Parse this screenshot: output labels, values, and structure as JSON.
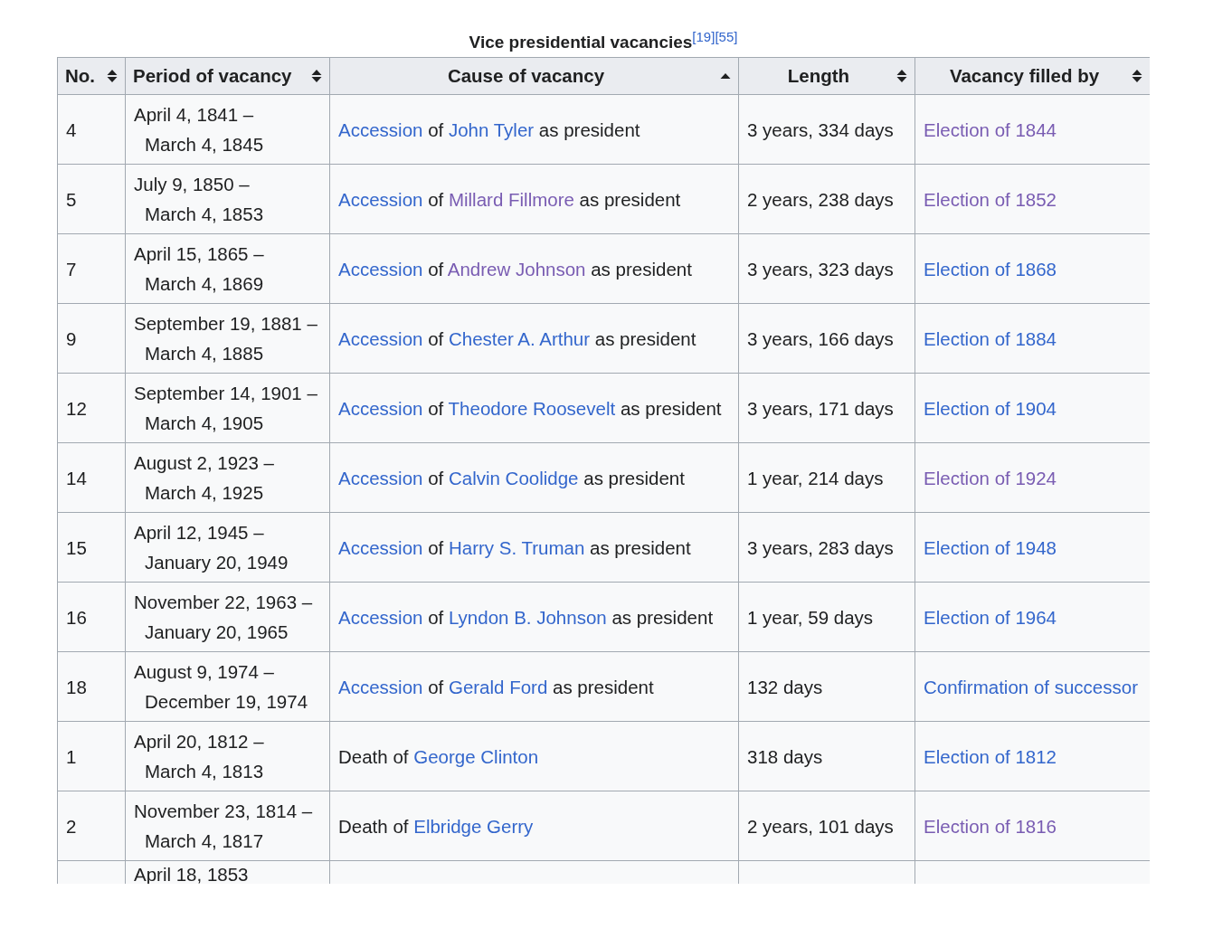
{
  "table": {
    "caption": "Vice presidential vacancies",
    "caption_refs": [
      "[19]",
      "[55]"
    ],
    "columns": [
      {
        "label": "No.",
        "sorted": false
      },
      {
        "label": "Period of vacancy",
        "sorted": false
      },
      {
        "label": "Cause of vacancy",
        "sorted": true
      },
      {
        "label": "Length",
        "sorted": false
      },
      {
        "label": "Vacancy filled by",
        "sorted": false
      }
    ],
    "rows": [
      {
        "no": "4",
        "period_start": "April 4, 1841 –",
        "period_end": "March 4, 1845",
        "cause": [
          {
            "text": "Accession",
            "link": true,
            "visited": false
          },
          {
            "text": " of ",
            "link": false
          },
          {
            "text": "John Tyler",
            "link": true,
            "visited": false
          },
          {
            "text": " as president",
            "link": false
          }
        ],
        "length": "3 years, 334 days",
        "filled_by": {
          "text": "Election of 1844",
          "visited": true
        }
      },
      {
        "no": "5",
        "period_start": "July 9, 1850 –",
        "period_end": "March 4, 1853",
        "cause": [
          {
            "text": "Accession",
            "link": true,
            "visited": false
          },
          {
            "text": " of ",
            "link": false
          },
          {
            "text": "Millard Fillmore",
            "link": true,
            "visited": true
          },
          {
            "text": " as president",
            "link": false
          }
        ],
        "length": "2 years, 238 days",
        "filled_by": {
          "text": "Election of 1852",
          "visited": true
        }
      },
      {
        "no": "7",
        "period_start": "April 15, 1865 –",
        "period_end": "March 4, 1869",
        "cause": [
          {
            "text": "Accession",
            "link": true,
            "visited": false
          },
          {
            "text": " of ",
            "link": false
          },
          {
            "text": "Andrew Johnson",
            "link": true,
            "visited": true
          },
          {
            "text": " as president",
            "link": false
          }
        ],
        "length": "3 years, 323 days",
        "filled_by": {
          "text": "Election of 1868",
          "visited": false
        }
      },
      {
        "no": "9",
        "period_start": "September 19, 1881 –",
        "period_end": "March 4, 1885",
        "cause": [
          {
            "text": "Accession",
            "link": true,
            "visited": false
          },
          {
            "text": " of ",
            "link": false
          },
          {
            "text": "Chester A. Arthur",
            "link": true,
            "visited": false
          },
          {
            "text": " as president",
            "link": false
          }
        ],
        "length": "3 years, 166 days",
        "filled_by": {
          "text": "Election of 1884",
          "visited": false
        }
      },
      {
        "no": "12",
        "period_start": "September 14, 1901 –",
        "period_end": "March 4, 1905",
        "cause": [
          {
            "text": "Accession",
            "link": true,
            "visited": false
          },
          {
            "text": " of ",
            "link": false
          },
          {
            "text": "Theodore Roosevelt",
            "link": true,
            "visited": false
          },
          {
            "text": " as president",
            "link": false
          }
        ],
        "length": "3 years, 171 days",
        "filled_by": {
          "text": "Election of 1904",
          "visited": false
        }
      },
      {
        "no": "14",
        "period_start": "August 2, 1923 –",
        "period_end": "March 4, 1925",
        "cause": [
          {
            "text": "Accession",
            "link": true,
            "visited": false
          },
          {
            "text": " of ",
            "link": false
          },
          {
            "text": "Calvin Coolidge",
            "link": true,
            "visited": false
          },
          {
            "text": " as president",
            "link": false
          }
        ],
        "length": "1 year, 214 days",
        "filled_by": {
          "text": "Election of 1924",
          "visited": true
        }
      },
      {
        "no": "15",
        "period_start": "April 12, 1945 –",
        "period_end": "January 20, 1949",
        "cause": [
          {
            "text": "Accession",
            "link": true,
            "visited": false
          },
          {
            "text": " of ",
            "link": false
          },
          {
            "text": "Harry S. Truman",
            "link": true,
            "visited": false
          },
          {
            "text": " as president",
            "link": false
          }
        ],
        "length": "3 years, 283 days",
        "filled_by": {
          "text": "Election of 1948",
          "visited": false
        }
      },
      {
        "no": "16",
        "period_start": "November 22, 1963 –",
        "period_end": "January 20, 1965",
        "cause": [
          {
            "text": "Accession",
            "link": true,
            "visited": false
          },
          {
            "text": " of ",
            "link": false
          },
          {
            "text": "Lyndon B. Johnson",
            "link": true,
            "visited": false
          },
          {
            "text": " as president",
            "link": false
          }
        ],
        "length": "1 year, 59 days",
        "filled_by": {
          "text": "Election of 1964",
          "visited": false
        }
      },
      {
        "no": "18",
        "period_start": "August 9, 1974 –",
        "period_end": "December 19, 1974",
        "cause": [
          {
            "text": "Accession",
            "link": true,
            "visited": false
          },
          {
            "text": " of ",
            "link": false
          },
          {
            "text": "Gerald Ford",
            "link": true,
            "visited": false
          },
          {
            "text": " as president",
            "link": false
          }
        ],
        "length": "132 days",
        "filled_by": {
          "text": "Confirmation of successor",
          "visited": false
        }
      },
      {
        "no": "1",
        "period_start": "April 20, 1812 –",
        "period_end": "March 4, 1813",
        "cause": [
          {
            "text": "Death of ",
            "link": false
          },
          {
            "text": "George Clinton",
            "link": true,
            "visited": false
          }
        ],
        "length": "318 days",
        "filled_by": {
          "text": "Election of 1812",
          "visited": false
        }
      },
      {
        "no": "2",
        "period_start": "November 23, 1814 –",
        "period_end": "March 4, 1817",
        "cause": [
          {
            "text": "Death of ",
            "link": false
          },
          {
            "text": "Elbridge Gerry",
            "link": true,
            "visited": false
          }
        ],
        "length": "2 years, 101 days",
        "filled_by": {
          "text": "Election of 1816",
          "visited": true
        }
      },
      {
        "period_start": "April 18, 1853"
      }
    ]
  }
}
